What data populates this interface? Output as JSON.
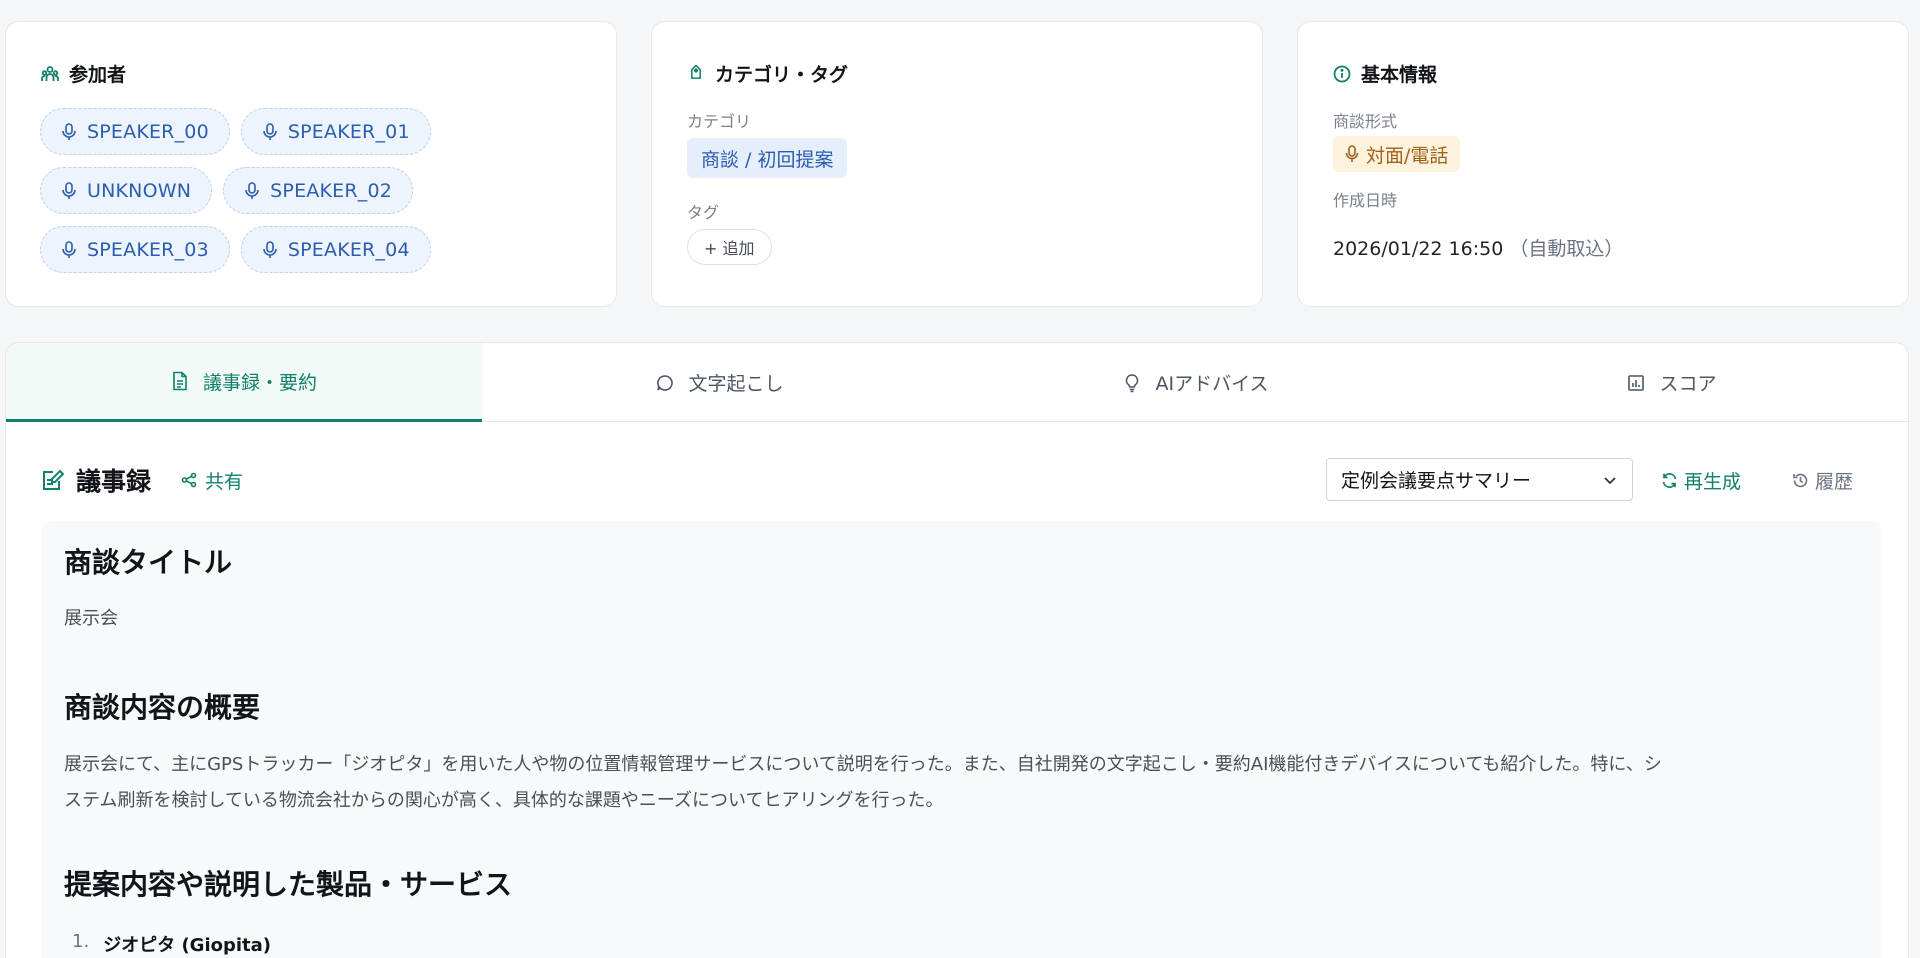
{
  "participants": {
    "title": "参加者",
    "speakers": [
      "SPEAKER_00",
      "SPEAKER_01",
      "UNKNOWN",
      "SPEAKER_02",
      "SPEAKER_03",
      "SPEAKER_04"
    ]
  },
  "category": {
    "title": "カテゴリ・タグ",
    "category_label": "カテゴリ",
    "category_value": "商談 / 初回提案",
    "tag_label": "タグ",
    "add_tag": "+ 追加"
  },
  "info": {
    "title": "基本情報",
    "type_label": "商談形式",
    "type_value": "対面/電話",
    "created_label": "作成日時",
    "created_value": "2026/01/22 16:50",
    "created_note": "（自動取込）"
  },
  "tabs": [
    {
      "label": "議事録・要約",
      "icon": "document-icon",
      "active": true
    },
    {
      "label": "文字起こし",
      "icon": "chat-bubble-icon",
      "active": false
    },
    {
      "label": "AIアドバイス",
      "icon": "lightbulb-icon",
      "active": false
    },
    {
      "label": "スコア",
      "icon": "bar-chart-icon",
      "active": false
    }
  ],
  "minutes": {
    "title": "議事録",
    "share": "共有",
    "template": "定例会議要点サマリー",
    "regenerate": "再生成",
    "history": "履歴"
  },
  "doc": {
    "h1": "商談タイトル",
    "p1": "展示会",
    "h2": "商談内容の概要",
    "p2_line1": "展示会にて、主にGPSトラッカー「ジオピタ」を用いた人や物の位置情報管理サービスについて説明を行った。また、自社開発の文字起こし・要約AI機能付きデバイスについても紹介した。特に、シ",
    "p2_line2": "ステム刷新を検討している物流会社からの関心が高く、具体的な課題やニーズについてヒアリングを行った。",
    "h3": "提案内容や説明した製品・サービス",
    "list": [
      {
        "num": "1.",
        "text": "ジオピタ (Giopita)"
      }
    ]
  },
  "colors": {
    "accent": "#12806a",
    "chip_text": "#2b5db0",
    "chip_bg": "#eef4fd",
    "warn_bg": "#fdf3dc",
    "warn_text": "#a2611a"
  }
}
